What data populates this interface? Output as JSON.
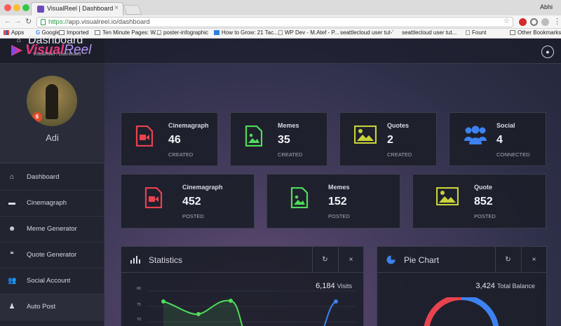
{
  "browser": {
    "tab_title": "VisualReel | Dashboard",
    "user_name": "Abhi",
    "url_scheme": "https://",
    "url_rest": "app.visualreel.io/dashboard",
    "bookmarks": [
      "Apps",
      "Google",
      "Imported",
      "Ten Minute Pages: W...",
      "poster-infographic",
      "How to Grow: 21 Tac...",
      "WP Dev - M.Atef - P...",
      "seattlecloud user tut-'",
      "seattlecloud user tut...",
      "Fount"
    ],
    "other_bookmarks": "Other Bookmarks"
  },
  "app": {
    "logo_bold": "Visual",
    "logo_rest": "Reel",
    "profile_name": "Adi",
    "page_title": "Dashboard",
    "breadcrumb": [
      "VisualReel",
      "Dashboard"
    ],
    "menu": [
      {
        "label": "Dashboard",
        "icon": "home-icon"
      },
      {
        "label": "Cinemagraph",
        "icon": "monitor-icon"
      },
      {
        "label": "Meme Generator",
        "icon": "smiley-icon"
      },
      {
        "label": "Quote Generator",
        "icon": "quote-icon"
      },
      {
        "label": "Social Account",
        "icon": "users-icon"
      },
      {
        "label": "Auto Post",
        "icon": "person-icon"
      }
    ],
    "stats_row1": [
      {
        "label": "Cinemagraph",
        "value": "46",
        "sub": "CREATED",
        "icon": "video-file-icon",
        "color": "#e8434f"
      },
      {
        "label": "Memes",
        "value": "35",
        "sub": "CREATED",
        "icon": "image-file-icon",
        "color": "#4fdc5a"
      },
      {
        "label": "Quotes",
        "value": "2",
        "sub": "CREATED",
        "icon": "picture-icon",
        "color": "#c8d23a"
      },
      {
        "label": "Social",
        "value": "4",
        "sub": "CONNECTED",
        "icon": "users-icon",
        "color": "#3d82f0"
      }
    ],
    "stats_row2": [
      {
        "label": "Cinemagraph",
        "value": "452",
        "sub": "POSTED",
        "icon": "video-file-icon",
        "color": "#e8434f"
      },
      {
        "label": "Memes",
        "value": "152",
        "sub": "POSTED",
        "icon": "image-file-icon",
        "color": "#4fdc5a"
      },
      {
        "label": "Quote",
        "value": "852",
        "sub": "POSTED",
        "icon": "picture-icon",
        "color": "#c8d23a"
      }
    ],
    "statistics": {
      "title": "Statistics",
      "metric_value": "6,184",
      "metric_unit": "Visits",
      "y_ticks": [
        "80",
        "75",
        "70"
      ]
    },
    "pie": {
      "title": "Pie Chart",
      "metric_value": "3,424",
      "metric_unit": "Total Balance"
    }
  }
}
